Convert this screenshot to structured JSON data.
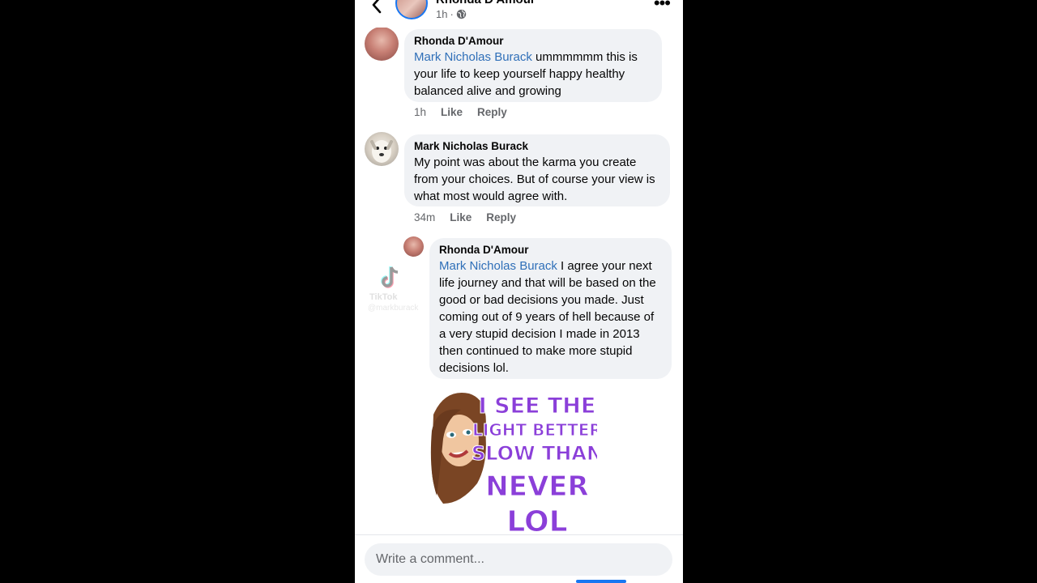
{
  "header": {
    "name": "Rhonda D'Amour",
    "time": "1h",
    "dot": "·"
  },
  "comments": [
    {
      "author": "Rhonda D'Amour",
      "mention": "Mark Nicholas Burack",
      "text": " ummmmmm this is your life to keep yourself happy healthy balanced alive and growing",
      "time": "1h",
      "like": "Like",
      "reply": "Reply"
    },
    {
      "author": "Mark Nicholas Burack",
      "text": "My point was about the karma you create from your choices. But of course your view is what most would agree with.",
      "time": "34m",
      "like": "Like",
      "reply": "Reply"
    },
    {
      "author": "Rhonda D'Amour",
      "mention": "Mark Nicholas Burack",
      "text": " I agree your next life journey and that will be based on the good or bad decisions you made. Just coming out of 9 years of hell because of a very stupid decision I made in 2013 then continued to make more stupid decisions lol."
    }
  ],
  "sticker": {
    "lines": [
      "I SEE THE",
      "LIGHT BETTER",
      "SLOW THAN",
      "NEVER",
      "LOL"
    ]
  },
  "watermark": {
    "brand": "TikTok",
    "handle": "@markburack"
  },
  "composer": {
    "placeholder": "Write a comment..."
  },
  "colors": {
    "mention": "#2f6fb8",
    "bubble": "#f0f2f5",
    "accent": "#1877f2",
    "sticker_text": "#8b3fd9"
  }
}
